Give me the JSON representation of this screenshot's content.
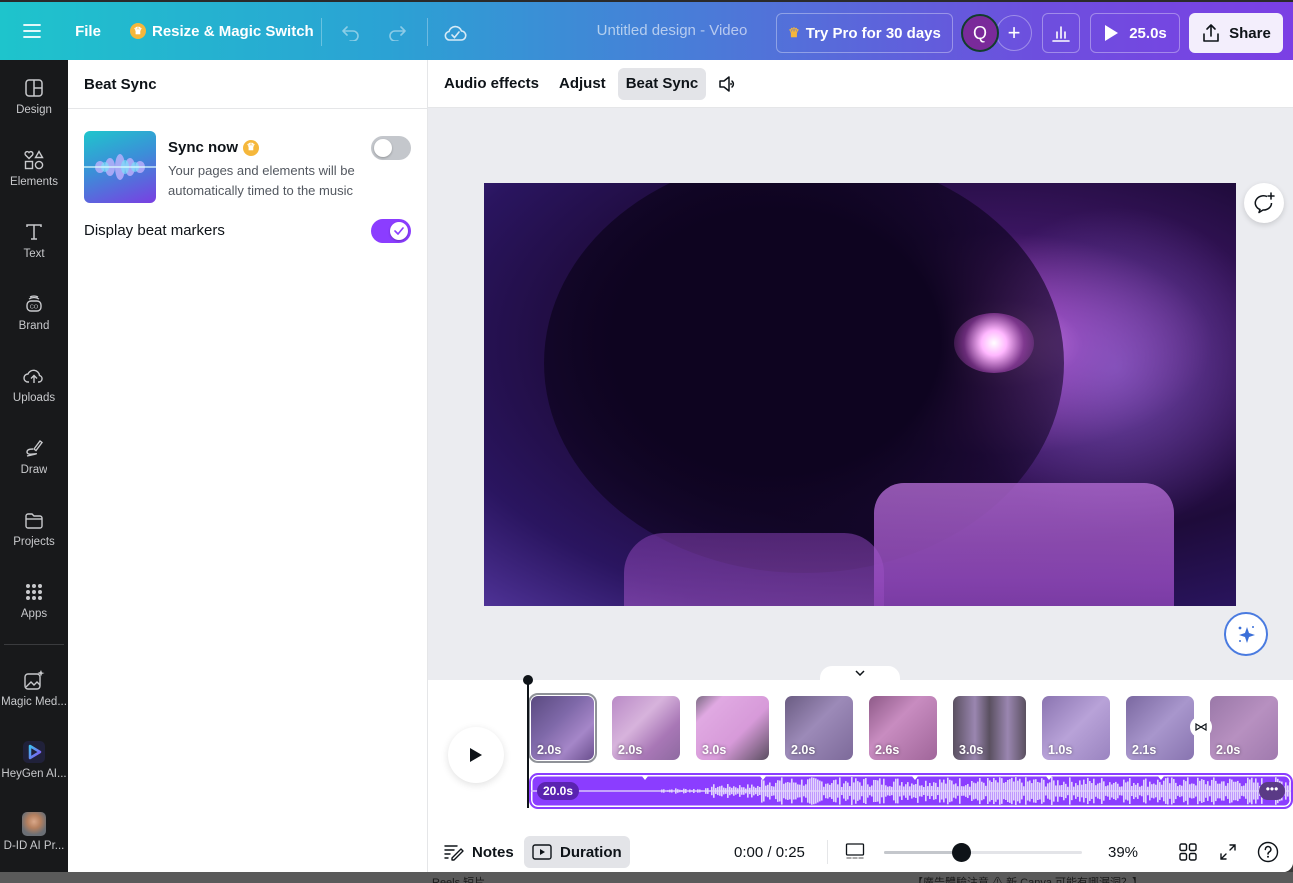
{
  "topbar": {
    "menu_icon": "hamburger-icon",
    "file_label": "File",
    "resize_label": "Resize & Magic Switch",
    "undo_icon": "undo-icon",
    "redo_icon": "redo-icon",
    "save_status_icon": "cloud-check-icon",
    "document_title": "Untitled design - Video",
    "try_pro_label": "Try Pro for 30 days",
    "avatar_initial": "Q",
    "add_collaborator": "+",
    "play_duration": "25.0s",
    "share_label": "Share"
  },
  "sidebar": {
    "items": [
      {
        "label": "Design",
        "icon": "design-layout-icon"
      },
      {
        "label": "Elements",
        "icon": "shapes-icon"
      },
      {
        "label": "Text",
        "icon": "text-icon"
      },
      {
        "label": "Brand",
        "icon": "brand-icon"
      },
      {
        "label": "Uploads",
        "icon": "cloud-upload-icon"
      },
      {
        "label": "Draw",
        "icon": "pen-icon"
      },
      {
        "label": "Projects",
        "icon": "folder-icon"
      },
      {
        "label": "Apps",
        "icon": "apps-grid-icon"
      }
    ],
    "apps": [
      {
        "label": "Magic Med...",
        "icon": "magic-media-icon"
      },
      {
        "label": "HeyGen AI...",
        "icon": "heygen-icon"
      },
      {
        "label": "D-ID AI Pr...",
        "icon": "d-id-avatar-icon"
      }
    ]
  },
  "panel": {
    "title": "Beat Sync",
    "sync_now_title": "Sync now",
    "sync_now_desc": "Your pages and elements will be automatically timed to the music",
    "sync_now_enabled": false,
    "beat_markers_label": "Display beat markers",
    "beat_markers_enabled": true
  },
  "context_toolbar": {
    "tabs": [
      {
        "label": "Audio effects",
        "active": false
      },
      {
        "label": "Adjust",
        "active": false
      },
      {
        "label": "Beat Sync",
        "active": true
      }
    ],
    "volume_icon": "volume-icon"
  },
  "timeline": {
    "clips": [
      {
        "duration": "2.0s",
        "selected": true
      },
      {
        "duration": "2.0s",
        "selected": false
      },
      {
        "duration": "3.0s",
        "selected": false
      },
      {
        "duration": "2.0s",
        "selected": false
      },
      {
        "duration": "2.6s",
        "selected": false
      },
      {
        "duration": "3.0s",
        "selected": false
      },
      {
        "duration": "1.0s",
        "selected": false
      },
      {
        "duration": "2.1s",
        "selected": false
      },
      {
        "duration": "2.0s",
        "selected": false
      }
    ],
    "audio_duration": "20.0s",
    "audio_more": "•••"
  },
  "bottombar": {
    "notes_label": "Notes",
    "duration_label": "Duration",
    "time_readout": "0:00 / 0:25",
    "zoom_percent": "39%",
    "zoom_level": 0.39
  },
  "background_text": {
    "left": "Reels 短片",
    "right": "【廣告體驗注意 ⚠ 新 Canva 可能有哪漏洞？】"
  },
  "colors": {
    "accent": "#8b3dff",
    "sidebar_bg": "#18191b",
    "pro_crown": "#f5b73b"
  }
}
